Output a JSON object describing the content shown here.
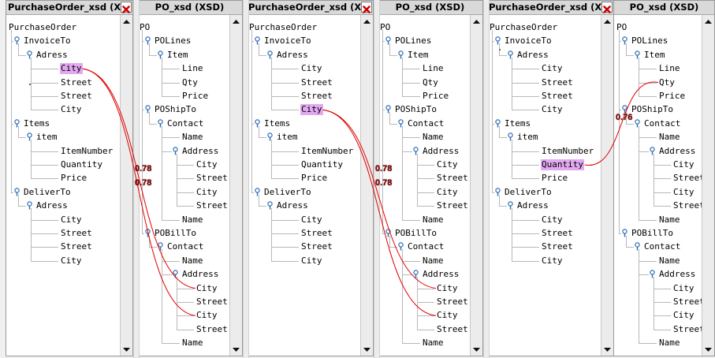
{
  "panels": [
    {
      "id": "s1",
      "title": "PurchaseOrder_xsd (XS",
      "kind": "source",
      "close_icon": "close-icon",
      "nodes": [
        {
          "label": "PurchaseOrder",
          "depth": 0
        },
        {
          "label": "InvoiceTo",
          "depth": 1,
          "expanded": true
        },
        {
          "label": "Adress",
          "depth": 2,
          "expanded": true
        },
        {
          "label": "City",
          "depth": 3,
          "selected": true
        },
        {
          "label": "Street",
          "depth": 3
        },
        {
          "label": "Street",
          "depth": 3
        },
        {
          "label": "City",
          "depth": 3
        },
        {
          "label": "Items",
          "depth": 1,
          "expanded": true
        },
        {
          "label": "item",
          "depth": 2,
          "expanded": true
        },
        {
          "label": "ItemNumber",
          "depth": 3
        },
        {
          "label": "Quantity",
          "depth": 3
        },
        {
          "label": "Price",
          "depth": 3
        },
        {
          "label": "DeliverTo",
          "depth": 1,
          "expanded": true
        },
        {
          "label": "Adress",
          "depth": 2,
          "expanded": true
        },
        {
          "label": "City",
          "depth": 3
        },
        {
          "label": "Street",
          "depth": 3
        },
        {
          "label": "Street",
          "depth": 3
        },
        {
          "label": "City",
          "depth": 3
        }
      ]
    },
    {
      "id": "t1",
      "title": "PO_xsd (XSD)",
      "kind": "target",
      "nodes": [
        {
          "label": "PO",
          "depth": 0
        },
        {
          "label": "POLines",
          "depth": 1,
          "expanded": true
        },
        {
          "label": "Item",
          "depth": 2,
          "expanded": true
        },
        {
          "label": "Line",
          "depth": 3
        },
        {
          "label": "Qty",
          "depth": 3
        },
        {
          "label": "Price",
          "depth": 3
        },
        {
          "label": "POShipTo",
          "depth": 1,
          "expanded": true
        },
        {
          "label": "Contact",
          "depth": 2,
          "expanded": true
        },
        {
          "label": "Name",
          "depth": 3
        },
        {
          "label": "Address",
          "depth": 3,
          "expanded": true
        },
        {
          "label": "City",
          "depth": 4
        },
        {
          "label": "Street",
          "depth": 4
        },
        {
          "label": "City",
          "depth": 4
        },
        {
          "label": "Street",
          "depth": 4
        },
        {
          "label": "Name",
          "depth": 3
        },
        {
          "label": "POBillTo",
          "depth": 1,
          "expanded": true
        },
        {
          "label": "Contact",
          "depth": 2,
          "expanded": true
        },
        {
          "label": "Name",
          "depth": 3
        },
        {
          "label": "Address",
          "depth": 3,
          "expanded": true
        },
        {
          "label": "City",
          "depth": 4
        },
        {
          "label": "Street",
          "depth": 4
        },
        {
          "label": "City",
          "depth": 4
        },
        {
          "label": "Street",
          "depth": 4
        },
        {
          "label": "Name",
          "depth": 3
        }
      ]
    },
    {
      "id": "s2",
      "title": "PurchaseOrder_xsd (XS",
      "kind": "source",
      "close_icon": "close-icon",
      "nodes": [
        {
          "label": "PurchaseOrder",
          "depth": 0
        },
        {
          "label": "InvoiceTo",
          "depth": 1,
          "expanded": true
        },
        {
          "label": "Adress",
          "depth": 2,
          "expanded": true
        },
        {
          "label": "City",
          "depth": 3
        },
        {
          "label": "Street",
          "depth": 3
        },
        {
          "label": "Street",
          "depth": 3
        },
        {
          "label": "City",
          "depth": 3,
          "selected": true
        },
        {
          "label": "Items",
          "depth": 1,
          "expanded": true
        },
        {
          "label": "item",
          "depth": 2,
          "expanded": true
        },
        {
          "label": "ItemNumber",
          "depth": 3
        },
        {
          "label": "Quantity",
          "depth": 3
        },
        {
          "label": "Price",
          "depth": 3
        },
        {
          "label": "DeliverTo",
          "depth": 1,
          "expanded": true
        },
        {
          "label": "Adress",
          "depth": 2,
          "expanded": true
        },
        {
          "label": "City",
          "depth": 3
        },
        {
          "label": "Street",
          "depth": 3
        },
        {
          "label": "Street",
          "depth": 3
        },
        {
          "label": "City",
          "depth": 3
        }
      ]
    },
    {
      "id": "t2",
      "title": "PO_xsd (XSD)",
      "kind": "target",
      "nodes": [
        {
          "label": "PO",
          "depth": 0
        },
        {
          "label": "POLines",
          "depth": 1,
          "expanded": true
        },
        {
          "label": "Item",
          "depth": 2,
          "expanded": true
        },
        {
          "label": "Line",
          "depth": 3
        },
        {
          "label": "Qty",
          "depth": 3
        },
        {
          "label": "Price",
          "depth": 3
        },
        {
          "label": "POShipTo",
          "depth": 1,
          "expanded": true
        },
        {
          "label": "Contact",
          "depth": 2,
          "expanded": true
        },
        {
          "label": "Name",
          "depth": 3
        },
        {
          "label": "Address",
          "depth": 3,
          "expanded": true
        },
        {
          "label": "City",
          "depth": 4
        },
        {
          "label": "Street",
          "depth": 4
        },
        {
          "label": "City",
          "depth": 4
        },
        {
          "label": "Street",
          "depth": 4
        },
        {
          "label": "Name",
          "depth": 3
        },
        {
          "label": "POBillTo",
          "depth": 1,
          "expanded": true
        },
        {
          "label": "Contact",
          "depth": 2,
          "expanded": true
        },
        {
          "label": "Name",
          "depth": 3
        },
        {
          "label": "Address",
          "depth": 3,
          "expanded": true
        },
        {
          "label": "City",
          "depth": 4
        },
        {
          "label": "Street",
          "depth": 4
        },
        {
          "label": "City",
          "depth": 4
        },
        {
          "label": "Street",
          "depth": 4
        },
        {
          "label": "Name",
          "depth": 3
        }
      ]
    },
    {
      "id": "s3",
      "title": "PurchaseOrder_xsd (XS",
      "kind": "source",
      "close_icon": "close-icon",
      "nodes": [
        {
          "label": "PurchaseOrder",
          "depth": 0
        },
        {
          "label": "InvoiceTo",
          "depth": 1,
          "expanded": true
        },
        {
          "label": "Adress",
          "depth": 2,
          "expanded": true
        },
        {
          "label": "City",
          "depth": 3
        },
        {
          "label": "Street",
          "depth": 3
        },
        {
          "label": "Street",
          "depth": 3
        },
        {
          "label": "City",
          "depth": 3
        },
        {
          "label": "Items",
          "depth": 1,
          "expanded": true
        },
        {
          "label": "item",
          "depth": 2,
          "expanded": true
        },
        {
          "label": "ItemNumber",
          "depth": 3
        },
        {
          "label": "Quantity",
          "depth": 3,
          "selected": true
        },
        {
          "label": "Price",
          "depth": 3
        },
        {
          "label": "DeliverTo",
          "depth": 1,
          "expanded": true
        },
        {
          "label": "Adress",
          "depth": 2,
          "expanded": true
        },
        {
          "label": "City",
          "depth": 3
        },
        {
          "label": "Street",
          "depth": 3
        },
        {
          "label": "Street",
          "depth": 3
        },
        {
          "label": "City",
          "depth": 3
        }
      ]
    },
    {
      "id": "t3",
      "title": "PO_xsd (XSD)",
      "kind": "target",
      "nodes": [
        {
          "label": "PO",
          "depth": 0
        },
        {
          "label": "POLines",
          "depth": 1,
          "expanded": true
        },
        {
          "label": "Item",
          "depth": 2,
          "expanded": true
        },
        {
          "label": "Line",
          "depth": 3
        },
        {
          "label": "Qty",
          "depth": 3
        },
        {
          "label": "Price",
          "depth": 3
        },
        {
          "label": "POShipTo",
          "depth": 1,
          "expanded": true
        },
        {
          "label": "Contact",
          "depth": 2,
          "expanded": true
        },
        {
          "label": "Name",
          "depth": 3
        },
        {
          "label": "Address",
          "depth": 3,
          "expanded": true
        },
        {
          "label": "City",
          "depth": 4
        },
        {
          "label": "Street",
          "depth": 4
        },
        {
          "label": "City",
          "depth": 4
        },
        {
          "label": "Street",
          "depth": 4
        },
        {
          "label": "Name",
          "depth": 3
        },
        {
          "label": "POBillTo",
          "depth": 1,
          "expanded": true
        },
        {
          "label": "Contact",
          "depth": 2,
          "expanded": true
        },
        {
          "label": "Name",
          "depth": 3
        },
        {
          "label": "Address",
          "depth": 3,
          "expanded": true
        },
        {
          "label": "City",
          "depth": 4
        },
        {
          "label": "Street",
          "depth": 4
        },
        {
          "label": "City",
          "depth": 4
        },
        {
          "label": "Street",
          "depth": 4
        },
        {
          "label": "Name",
          "depth": 3
        }
      ]
    }
  ],
  "mappings": [
    {
      "src_panel": 0,
      "src_node": 3,
      "tgt_panel": 1,
      "tgt_node": 19,
      "score": "0.78"
    },
    {
      "src_panel": 0,
      "src_node": 3,
      "tgt_panel": 1,
      "tgt_node": 21,
      "score": "0.78"
    },
    {
      "src_panel": 2,
      "src_node": 6,
      "tgt_panel": 3,
      "tgt_node": 19,
      "score": "0.78"
    },
    {
      "src_panel": 2,
      "src_node": 6,
      "tgt_panel": 3,
      "tgt_node": 21,
      "score": "0.78"
    },
    {
      "src_panel": 4,
      "src_node": 10,
      "tgt_panel": 5,
      "tgt_node": 4,
      "score": "0.76"
    }
  ],
  "colors": {
    "selection": "#e2a8f0",
    "mapping_line": "#e00000",
    "score_text": "#8b0000",
    "close_button": "#cc0000",
    "tree_connector": "#b8b8b8",
    "expander": "#2a6db5"
  }
}
